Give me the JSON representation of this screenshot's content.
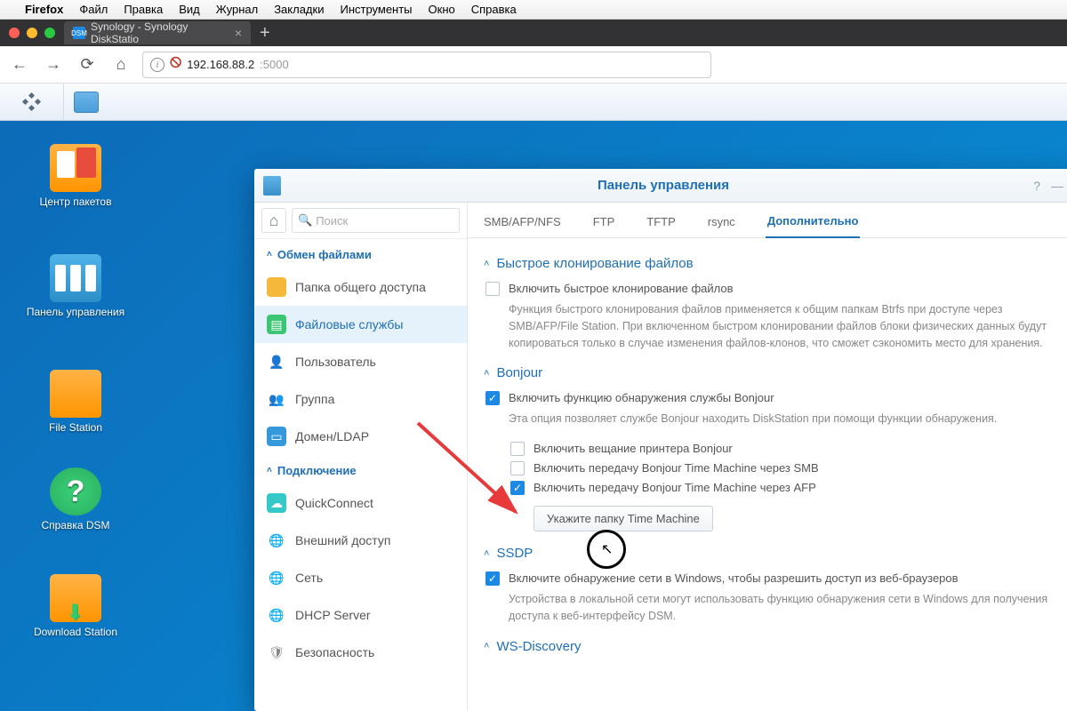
{
  "mac_menu": {
    "app": "Firefox",
    "items": [
      "Файл",
      "Правка",
      "Вид",
      "Журнал",
      "Закладки",
      "Инструменты",
      "Окно",
      "Справка"
    ]
  },
  "browser": {
    "tab_title": "Synology - Synology DiskStatio",
    "host": "192.168.88.2",
    "port": ":5000"
  },
  "desktop": {
    "pkg_center": "Центр пакетов",
    "control_panel": "Панель управления",
    "file_station": "File Station",
    "help": "Справка DSM",
    "download": "Download Station"
  },
  "cp": {
    "title": "Панель управления",
    "search_placeholder": "Поиск",
    "groups": {
      "file_share": "Обмен файлами",
      "connection": "Подключение"
    },
    "nav": {
      "shared_folder": "Папка общего доступа",
      "file_services": "Файловые службы",
      "user": "Пользователь",
      "group": "Группа",
      "domain": "Домен/LDAP",
      "quickconnect": "QuickConnect",
      "external": "Внешний доступ",
      "network": "Сеть",
      "dhcp": "DHCP Server",
      "security": "Безопасность"
    },
    "tabs": {
      "smb": "SMB/AFP/NFS",
      "ftp": "FTP",
      "tftp": "TFTP",
      "rsync": "rsync",
      "advanced": "Дополнительно"
    },
    "sections": {
      "fastclone": {
        "title": "Быстрое клонирование файлов",
        "chk": "Включить быстрое клонирование файлов",
        "desc": "Функция быстрого клонирования файлов применяется к общим папкам Btrfs при доступе через SMB/AFP/File Station. При включенном быстром клонировании файлов блоки физических данных будут копироваться только в случае изменения файлов-клонов, что сможет сэкономить место для хранения."
      },
      "bonjour": {
        "title": "Bonjour",
        "enable": "Включить функцию обнаружения службы Bonjour",
        "desc": "Эта опция позволяет службе Bonjour находить DiskStation при помощи функции обнаружения.",
        "printer": "Включить вещание принтера Bonjour",
        "tm_smb": "Включить передачу Bonjour Time Machine через SMB",
        "tm_afp": "Включить передачу Bonjour Time Machine через AFP",
        "btn": "Укажите папку Time Machine"
      },
      "ssdp": {
        "title": "SSDP",
        "enable": "Включите обнаружение сети в Windows, чтобы разрешить доступ из веб-браузеров",
        "desc": "Устройства в локальной сети могут использовать функцию обнаружения сети в Windows для получения доступа к веб-интерфейсу DSM."
      },
      "ws": {
        "title": "WS-Discovery"
      }
    }
  }
}
